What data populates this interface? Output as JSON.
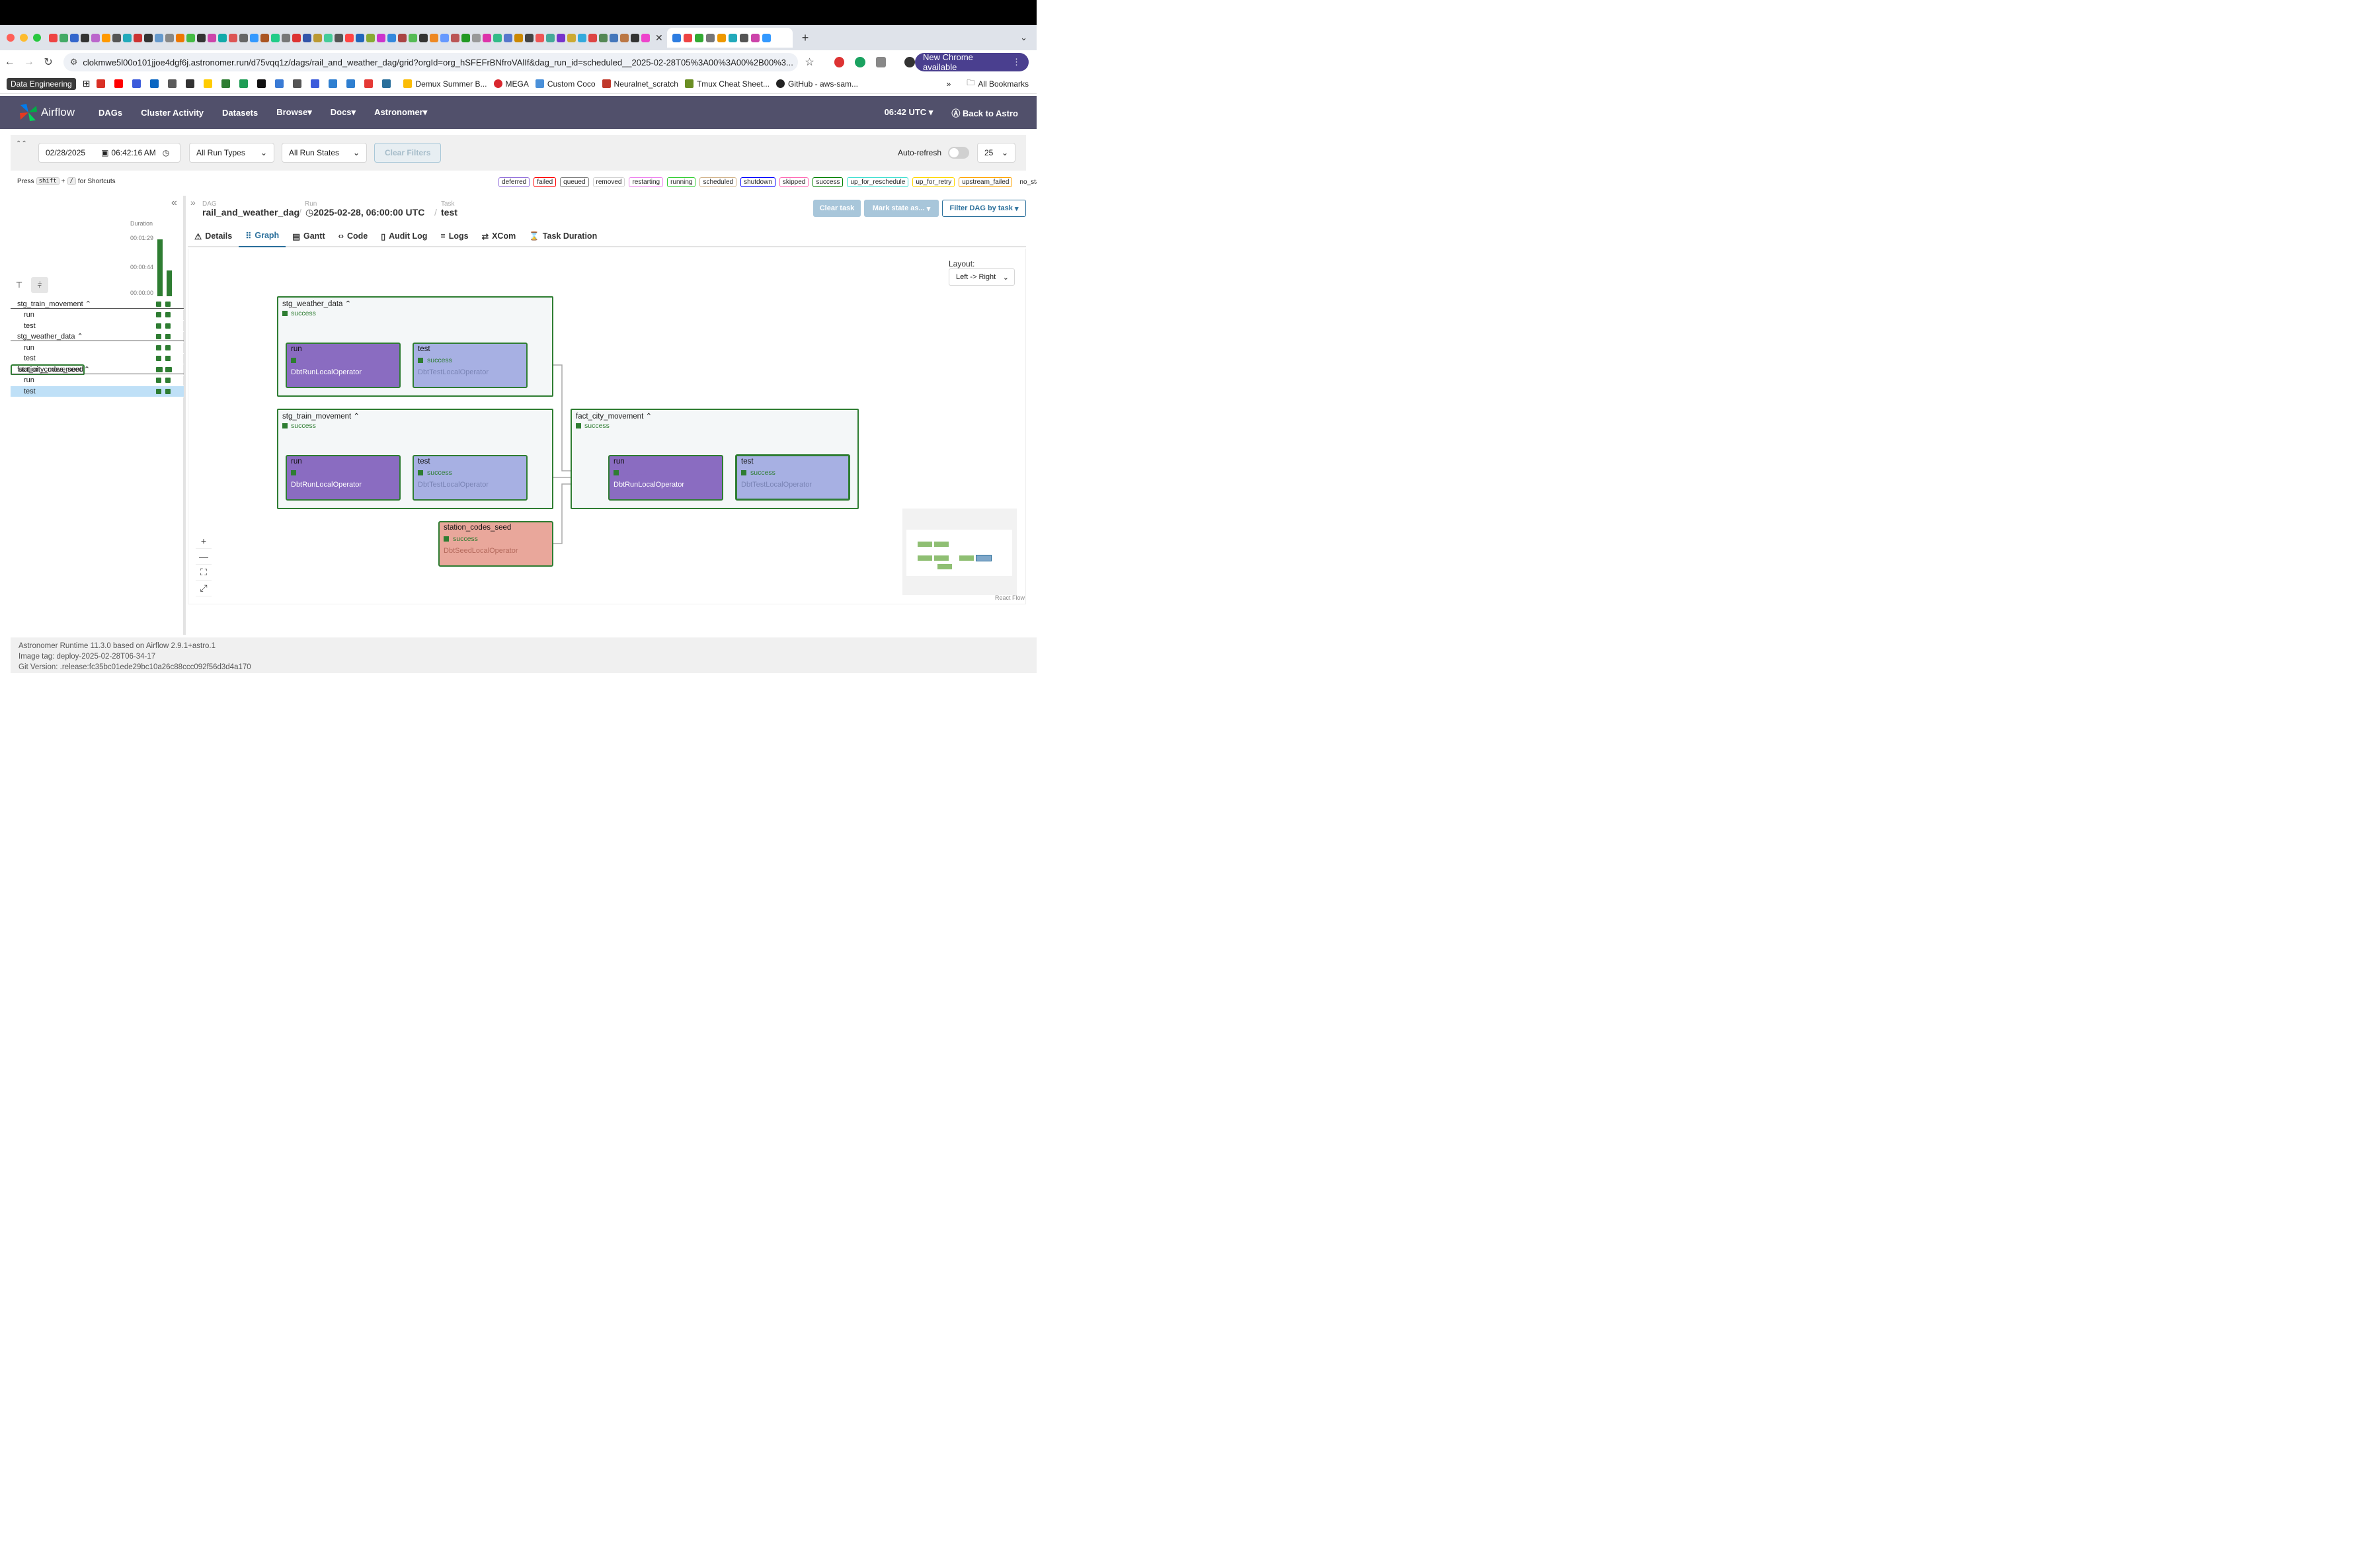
{
  "browser": {
    "url": "clokmwe5l00o101jjoe4dgf6j.astronomer.run/d75vqq1z/dags/rail_and_weather_dag/grid?orgId=org_hSFEFrBNfroVAlIf&dag_run_id=scheduled__2025-02-28T05%3A00%3A00%2B00%3...",
    "new_chrome": "New Chrome available",
    "bookmarks": [
      "Data Engineering",
      "Demux Summer B...",
      "MEGA",
      "Custom Coco",
      "Neuralnet_scratch",
      "Tmux Cheat Sheet...",
      "GitHub - aws-sam...",
      "All Bookmarks"
    ]
  },
  "nav": {
    "brand": "Airflow",
    "items": [
      "DAGs",
      "Cluster Activity",
      "Datasets",
      "Browse",
      "Docs",
      "Astronomer"
    ],
    "time": "06:42 UTC",
    "back": "Back to Astro"
  },
  "filters": {
    "date": "02/28/2025",
    "time": "06:42:16 AM",
    "run_types": "All Run Types",
    "run_states": "All Run States",
    "clear": "Clear Filters",
    "autorefresh": "Auto-refresh",
    "page_size": "25"
  },
  "shortcut": {
    "press": "Press",
    "k1": "shift",
    "plus": "+",
    "k2": "/",
    "suffix": "for Shortcuts"
  },
  "legend": [
    {
      "label": "deferred",
      "color": "#9370db"
    },
    {
      "label": "failed",
      "color": "#ff0000"
    },
    {
      "label": "queued",
      "color": "#808080"
    },
    {
      "label": "removed",
      "color": "#d3d3d3"
    },
    {
      "label": "restarting",
      "color": "#ee82ee"
    },
    {
      "label": "running",
      "color": "#32cd32"
    },
    {
      "label": "scheduled",
      "color": "#d2b48c"
    },
    {
      "label": "shutdown",
      "color": "#0000ff"
    },
    {
      "label": "skipped",
      "color": "#ff69b4"
    },
    {
      "label": "success",
      "color": "#008000"
    },
    {
      "label": "up_for_reschedule",
      "color": "#40e0d0"
    },
    {
      "label": "up_for_retry",
      "color": "#ffd700"
    },
    {
      "label": "upstream_failed",
      "color": "#ffa500"
    },
    {
      "label": "no_status",
      "color": "#ffffff"
    }
  ],
  "grid": {
    "duration_label": "Duration",
    "ticks": [
      "00:01:29",
      "00:00:44",
      "00:00:00"
    ],
    "rows": [
      {
        "name": "stg_train_movement",
        "kind": "group"
      },
      {
        "name": "run",
        "kind": "child"
      },
      {
        "name": "test",
        "kind": "child"
      },
      {
        "name": "stg_weather_data",
        "kind": "group"
      },
      {
        "name": "run",
        "kind": "child"
      },
      {
        "name": "test",
        "kind": "child"
      },
      {
        "name": "station_codes_seed",
        "kind": "task"
      },
      {
        "name": "fact_city_movement",
        "kind": "group"
      },
      {
        "name": "run",
        "kind": "child"
      },
      {
        "name": "test",
        "kind": "child",
        "selected": true
      }
    ]
  },
  "breadcrumb": {
    "dag_label": "DAG",
    "dag": "rail_and_weather_dag",
    "run_label": "Run",
    "run": "2025-02-28, 06:00:00 UTC",
    "task_label": "Task",
    "task": "test"
  },
  "actions": {
    "clear_task": "Clear task",
    "mark_state": "Mark state as...",
    "filter": "Filter DAG by task"
  },
  "tabs": [
    "Details",
    "Graph",
    "Gantt",
    "Code",
    "Audit Log",
    "Logs",
    "XCom",
    "Task Duration"
  ],
  "layout": {
    "label": "Layout:",
    "value": "Left -> Right"
  },
  "graph": {
    "groups": [
      {
        "id": "g_weather",
        "title": "stg_weather_data",
        "state": "success"
      },
      {
        "id": "g_train",
        "title": "stg_train_movement",
        "state": "success"
      },
      {
        "id": "g_fact",
        "title": "fact_city_movement",
        "state": "success"
      }
    ],
    "tasks": [
      {
        "name": "run",
        "state": "success",
        "operator": "DbtRunLocalOperator"
      },
      {
        "name": "test",
        "state": "success",
        "operator": "DbtTestLocalOperator"
      },
      {
        "name": "run",
        "state": "success",
        "operator": "DbtRunLocalOperator"
      },
      {
        "name": "test",
        "state": "success",
        "operator": "DbtTestLocalOperator"
      },
      {
        "name": "run",
        "state": "success",
        "operator": "DbtRunLocalOperator"
      },
      {
        "name": "test",
        "state": "success",
        "operator": "DbtTestLocalOperator"
      },
      {
        "name": "station_codes_seed",
        "state": "success",
        "operator": "DbtSeedLocalOperator"
      }
    ],
    "react_flow": "React Flow"
  },
  "footer": {
    "runtime": "Astronomer Runtime 11.3.0 based on Airflow 2.9.1+astro.1",
    "image": "Image tag: deploy-2025-02-28T06-34-17",
    "git": "Git Version: .release:fc35bc01ede29bc10a26c88ccc092f56d3d4a170"
  }
}
